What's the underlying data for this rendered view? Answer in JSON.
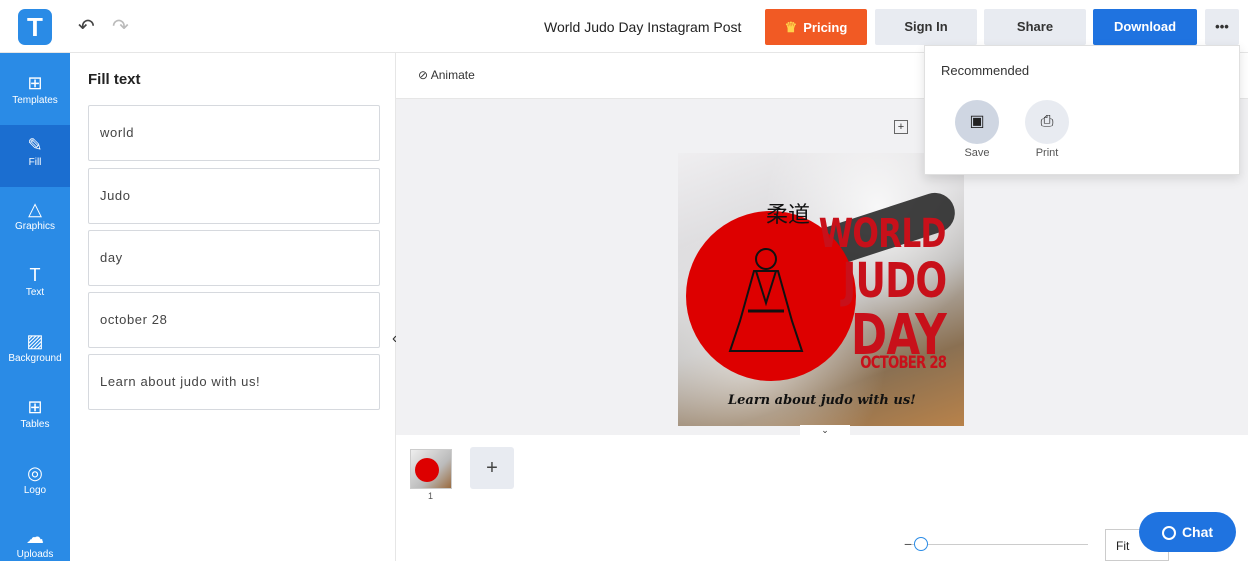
{
  "topbar": {
    "logo_letter": "T",
    "doc_title": "World Judo Day Instagram Post",
    "pricing_label": "Pricing",
    "signin_label": "Sign In",
    "share_label": "Share",
    "download_label": "Download",
    "more_label": "•••"
  },
  "sidebar": {
    "items": [
      {
        "label": "Templates",
        "icon": "templates-icon"
      },
      {
        "label": "Fill",
        "icon": "pencil-icon"
      },
      {
        "label": "Graphics",
        "icon": "shapes-icon"
      },
      {
        "label": "Text",
        "icon": "text-icon"
      },
      {
        "label": "Background",
        "icon": "background-icon"
      },
      {
        "label": "Tables",
        "icon": "table-icon"
      },
      {
        "label": "Logo",
        "icon": "logo-icon"
      },
      {
        "label": "Uploads",
        "icon": "upload-cloud-icon"
      }
    ]
  },
  "fill": {
    "title": "Fill text",
    "fields": [
      "world",
      "Judo",
      "day",
      "october 28",
      "Learn about judo with us!"
    ]
  },
  "canvas": {
    "animate_label": "Animate",
    "post": {
      "kanji": "柔道",
      "word1": "WORLD",
      "word2": "JUDO",
      "word3": "DAY",
      "date": "OCTOBER 28",
      "tagline": "Learn about judo with us!"
    }
  },
  "pages": {
    "page_number": "1",
    "add_label": "+"
  },
  "zoom": {
    "fit_label": "Fit"
  },
  "chat": {
    "label": "Chat"
  },
  "dropdown": {
    "title": "Recommended",
    "save_label": "Save",
    "print_label": "Print"
  },
  "colors": {
    "brand_blue": "#2a8be6",
    "pricing_orange": "#f15a24",
    "download_blue": "#1f73e0",
    "judo_red": "#c8101a"
  }
}
